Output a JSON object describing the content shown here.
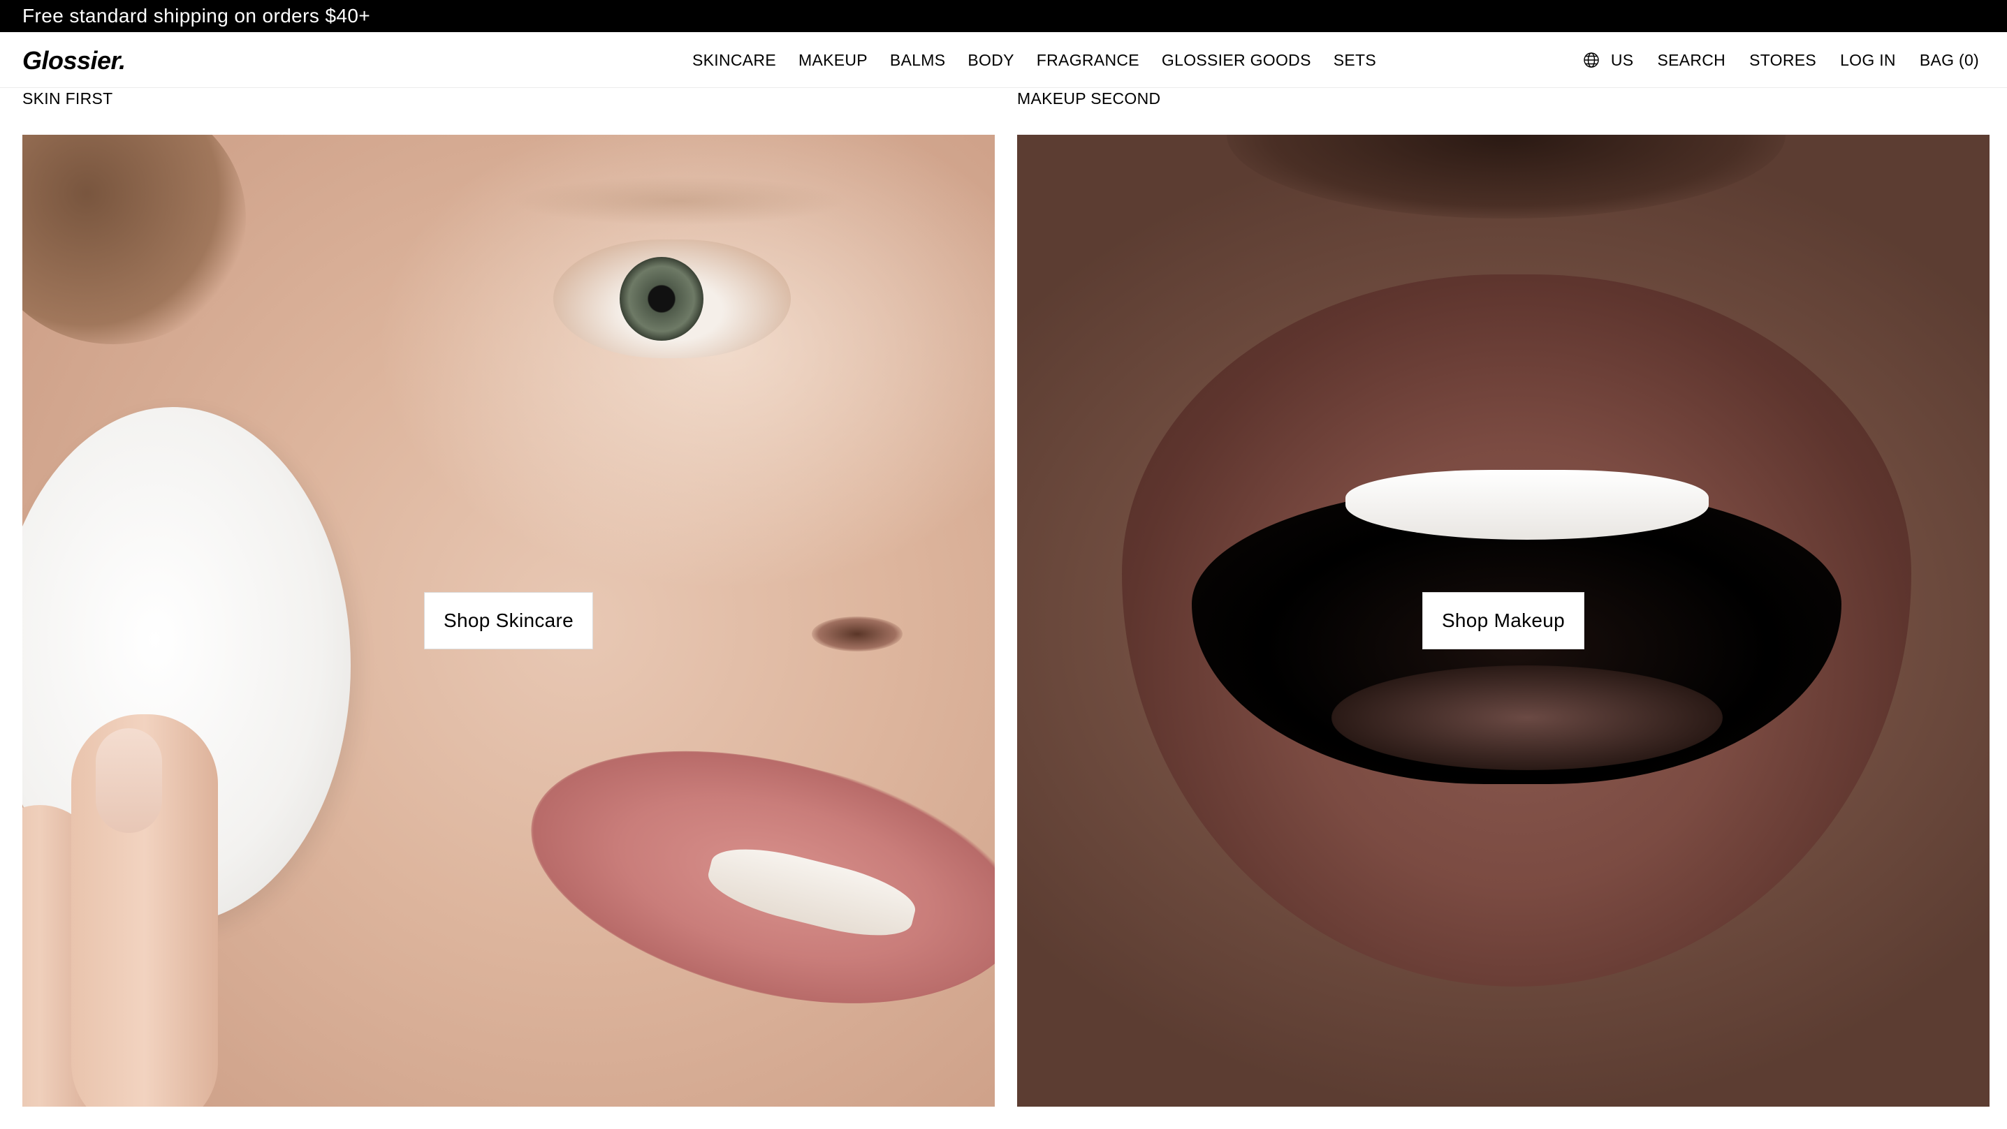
{
  "announcement": {
    "text": "Free standard shipping on orders $40+"
  },
  "header": {
    "logo": "Glossier.",
    "nav_center": [
      "SKINCARE",
      "MAKEUP",
      "BALMS",
      "BODY",
      "FRAGRANCE",
      "GLOSSIER GOODS",
      "SETS"
    ],
    "region": {
      "icon": "globe-icon",
      "label": "US"
    },
    "nav_right": {
      "search": "SEARCH",
      "stores": "STORES",
      "login": "LOG IN",
      "bag": "BAG (0)"
    }
  },
  "sections": [
    {
      "label": "SKIN FIRST",
      "button": "Shop Skincare"
    },
    {
      "label": "MAKEUP SECOND",
      "button": "Shop Makeup"
    }
  ],
  "colors": {
    "announcement_bg": "#000000",
    "page_bg": "#ffffff",
    "button_bg": "#ffffff"
  }
}
